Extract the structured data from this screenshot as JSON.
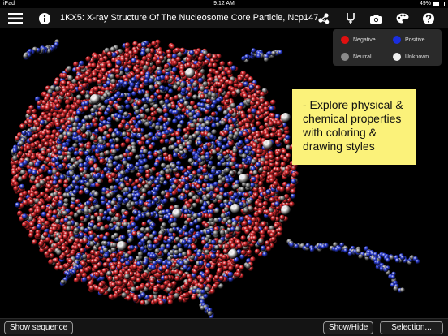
{
  "status": {
    "carrier": "iPad",
    "time": "9:12 AM",
    "battery": "49%"
  },
  "toolbar": {
    "title": "1KX5: X-ray Structure Of The Nucleosome Core Particle, Ncp147,..."
  },
  "legend": {
    "items": [
      {
        "label": "Negative",
        "color": "#e01010"
      },
      {
        "label": "Positive",
        "color": "#1a2ee0"
      },
      {
        "label": "Neutral",
        "color": "#8a8a8a"
      },
      {
        "label": "Unknown",
        "color": "#f0f0f0"
      }
    ]
  },
  "note": {
    "lines": [
      "- Explore physical &",
      "chemical  properties",
      "with coloring &",
      "drawing styles"
    ]
  },
  "bottom": {
    "show_sequence": "Show sequence",
    "show_hide": "Show/Hide",
    "selection": "Selection..."
  },
  "colors": {
    "negative": "#d8262b",
    "positive": "#2c3ed8",
    "neutral": "#8c8c8c",
    "unknown": "#f2f2f2"
  }
}
